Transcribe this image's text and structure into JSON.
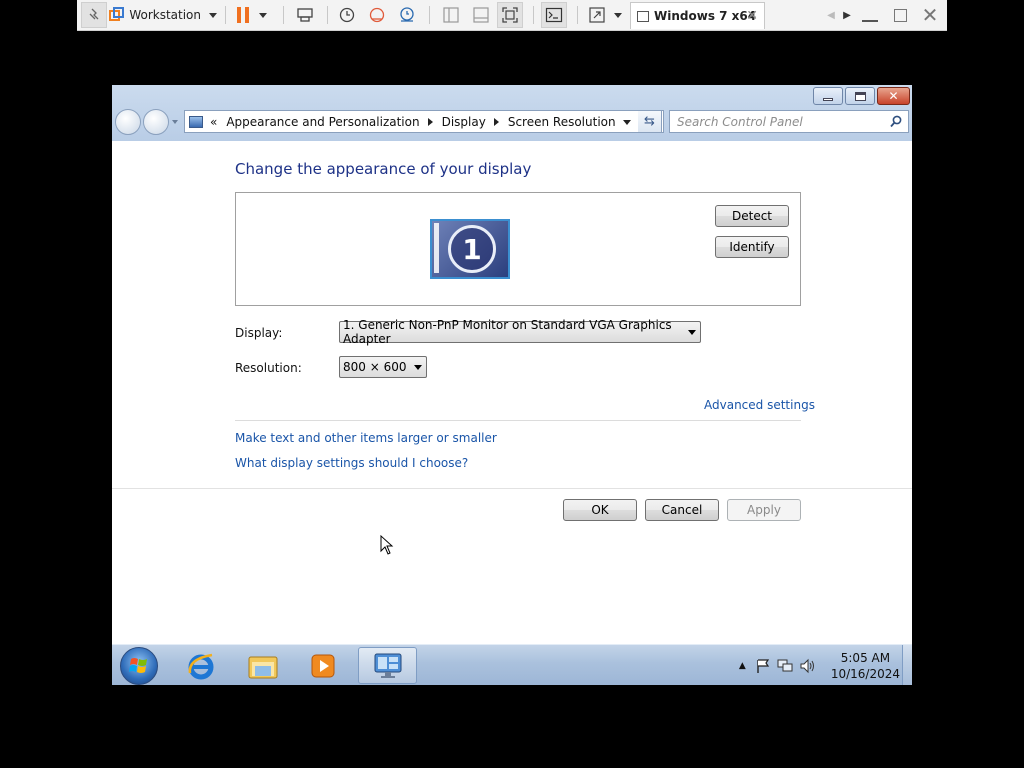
{
  "vm_toolbar": {
    "menu_label": "Workstation",
    "vm_tab_title": "Windows 7 x64"
  },
  "window": {
    "breadcrumb": {
      "prefix": "«",
      "items": [
        "Appearance and Personalization",
        "Display",
        "Screen Resolution"
      ]
    },
    "search": {
      "placeholder": "Search Control Panel"
    }
  },
  "content": {
    "title": "Change the appearance of your display",
    "monitor_number": "1",
    "detect_label": "Detect",
    "identify_label": "Identify",
    "display_label": "Display:",
    "display_value": "1. Generic Non-PnP Monitor on Standard VGA Graphics Adapter",
    "resolution_label": "Resolution:",
    "resolution_value": "800 × 600",
    "advanced_link": "Advanced settings",
    "link_text_size": "Make text and other items larger or smaller",
    "link_help": "What display settings should I choose?",
    "ok_label": "OK",
    "cancel_label": "Cancel",
    "apply_label": "Apply"
  },
  "taskbar": {
    "time": "5:05 AM",
    "date": "10/16/2024"
  },
  "colors": {
    "title_blue": "#1e3287",
    "link_blue": "#1a55a8",
    "taskbar": "#aac1dd"
  }
}
